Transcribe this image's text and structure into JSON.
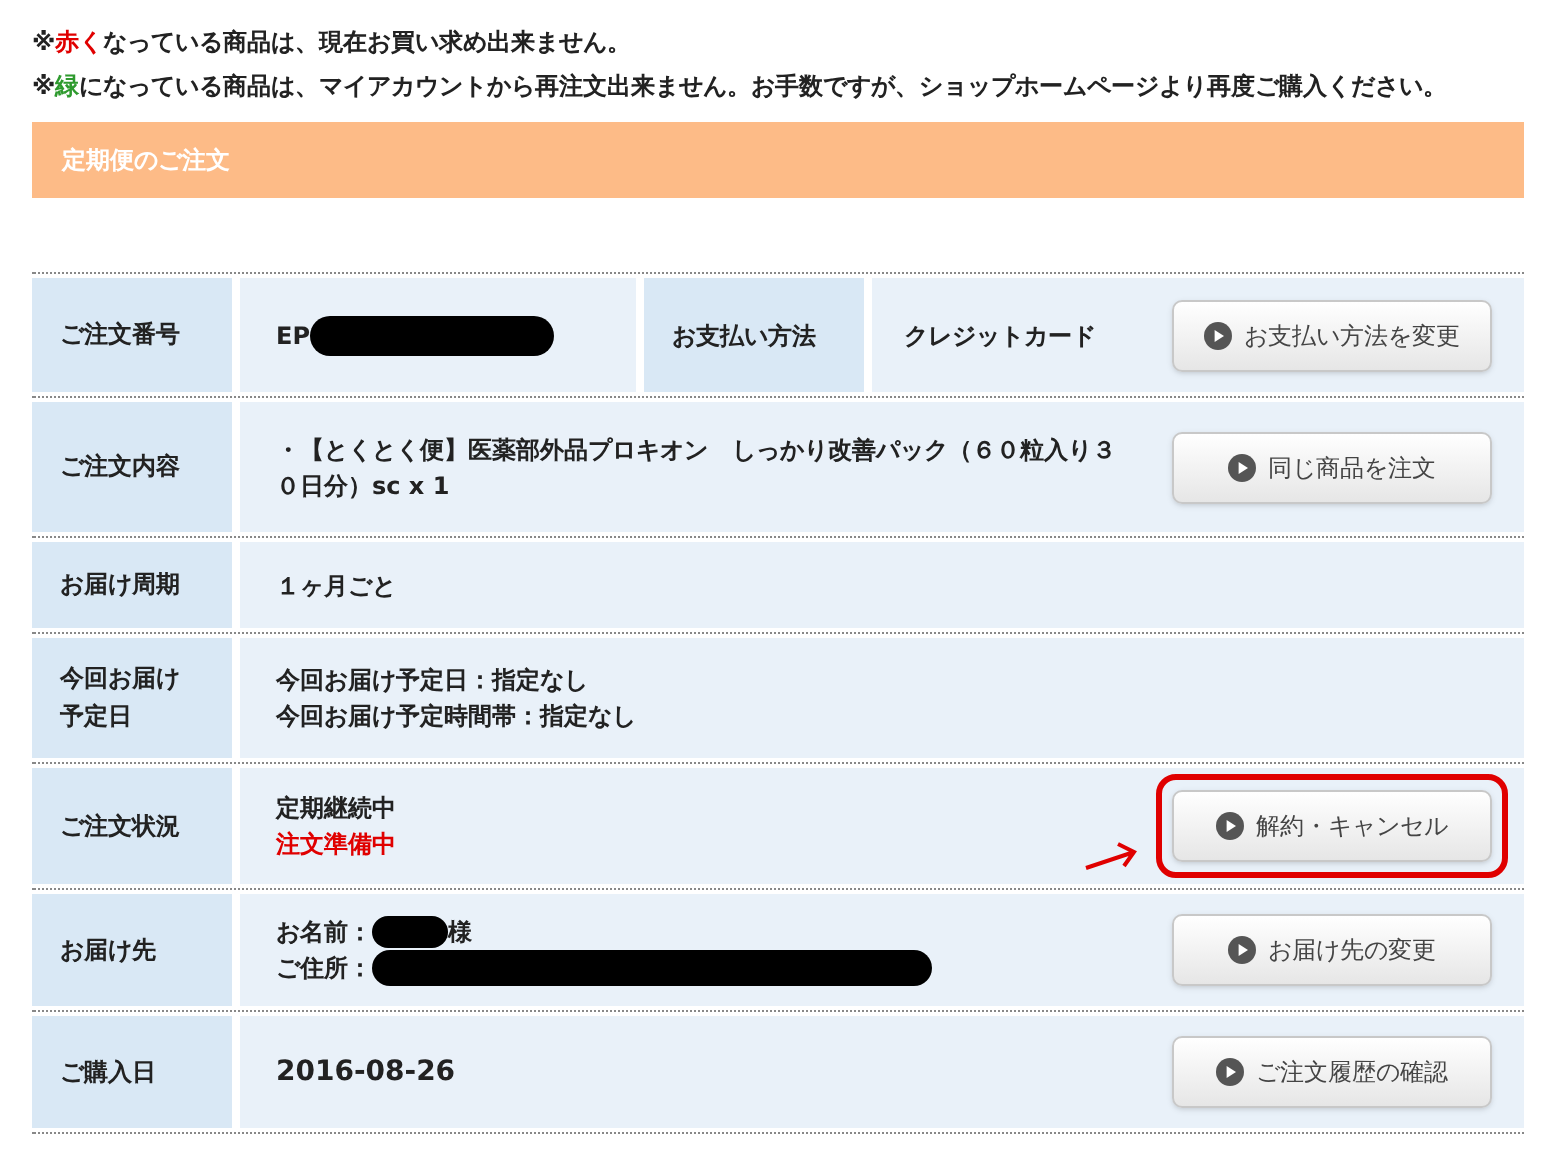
{
  "notes": [
    {
      "prefix": "※",
      "colored": "赤く",
      "color": "#e00000",
      "rest": "なっている商品は、現在お買い求め出来ません。"
    },
    {
      "prefix": "※",
      "colored": "緑",
      "color": "#2e9a2e",
      "rest": "になっている商品は、マイアカウントから再注文出来ません。お手数ですが、ショップホームページより再度ご購入ください。"
    }
  ],
  "section_title": "定期便のご注文",
  "rows": [
    {
      "label": "ご注文番号",
      "lines": [
        {
          "text": "EP",
          "redacted": true
        }
      ],
      "sub_label": "お支払い方法",
      "sub_value": "クレジットカード",
      "button": {
        "label": "お支払い方法を変更",
        "highlighted": false
      }
    },
    {
      "label": "ご注文内容",
      "lines": [
        {
          "text": "・【とくとく便】医薬部外品プロキオン　しっかり改善パック（６０粒入り３０日分）sc x 1"
        }
      ],
      "button": {
        "label": "同じ商品を注文",
        "highlighted": false
      }
    },
    {
      "label": "お届け周期",
      "lines": [
        {
          "text": "１ヶ月ごと"
        }
      ]
    },
    {
      "label": "今回お届け予定日",
      "lines": [
        {
          "text": "今回お届け予定日：指定なし"
        },
        {
          "text": "今回お届け予定時間帯：指定なし"
        }
      ]
    },
    {
      "label": "ご注文状況",
      "lines": [
        {
          "text": "定期継続中",
          "color": "#222222"
        },
        {
          "text": "注文準備中",
          "color": "#e00000"
        }
      ],
      "button": {
        "label": "解約・キャンセル",
        "highlighted": true
      }
    },
    {
      "label": "お届け先",
      "lines": [
        {
          "text": "お名前：",
          "redacted": true,
          "suffix": "様"
        },
        {
          "text": "ご住所：",
          "redacted": true
        }
      ],
      "button": {
        "label": "お届け先の変更",
        "highlighted": false
      }
    },
    {
      "label": "ご購入日",
      "lines": [
        {
          "text": "2016-08-26",
          "large": true
        }
      ],
      "button": {
        "label": "ご注文履歴の確認",
        "highlighted": false
      }
    }
  ]
}
